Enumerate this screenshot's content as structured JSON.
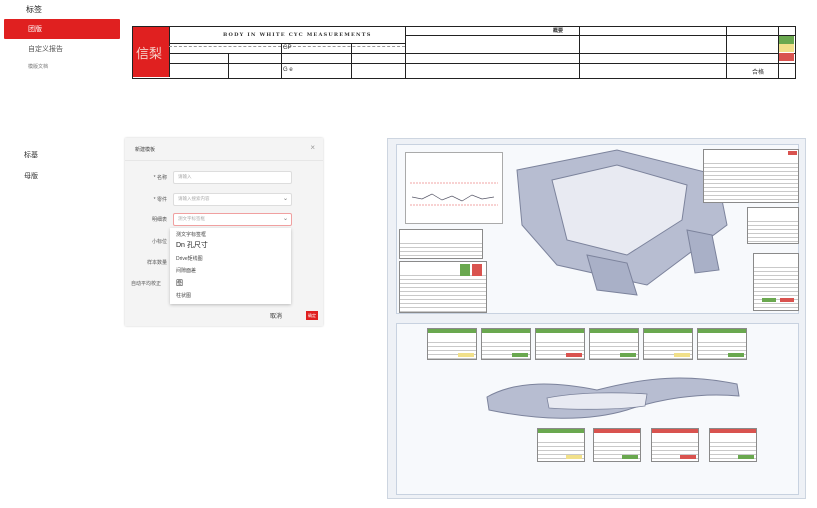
{
  "nav": {
    "title": "标签",
    "active_item": "团版",
    "sub_item_1": "自定义报告",
    "sub_item_2": "模版文档"
  },
  "header_sheet": {
    "brand": "信梨",
    "doc_title": "BODY IN WHITE CYC MEASUREMENTS",
    "summary_label": "概要",
    "cell_gp": "GP",
    "cell_ge": "G e",
    "cell_pass": "合格"
  },
  "labels": {
    "label_a": "标基",
    "label_b": "母版"
  },
  "modal": {
    "title": "新建模板",
    "close": "×",
    "fields": [
      {
        "label": "* 名称",
        "placeholder": "请输入"
      },
      {
        "label": "* 零件",
        "placeholder": "请输入搜索内容"
      },
      {
        "label": "明细表",
        "placeholder": "测文字标签框"
      },
      {
        "label": "小标位",
        "placeholder": ""
      },
      {
        "label": "样本数量",
        "placeholder": ""
      }
    ],
    "side_label": "自动平均校正",
    "dropdown_options": [
      {
        "text": "测文字标签框",
        "big": false
      },
      {
        "text": "Dn 孔尺寸",
        "big": true
      },
      {
        "text": "Drive矩线图",
        "big": false
      },
      {
        "text": "间隙面差",
        "big": false
      },
      {
        "text": "图",
        "big": true
      },
      {
        "text": "柱状图",
        "big": false
      }
    ],
    "cancel": "取消",
    "ok": "确定"
  },
  "colors": {
    "accent": "#e02020",
    "status_green": "#6aa84f",
    "status_yellow": "#f1e08a",
    "status_red": "#d9534f"
  },
  "icons": {
    "close": "close-icon",
    "dropdown": "chevron-down-icon"
  }
}
